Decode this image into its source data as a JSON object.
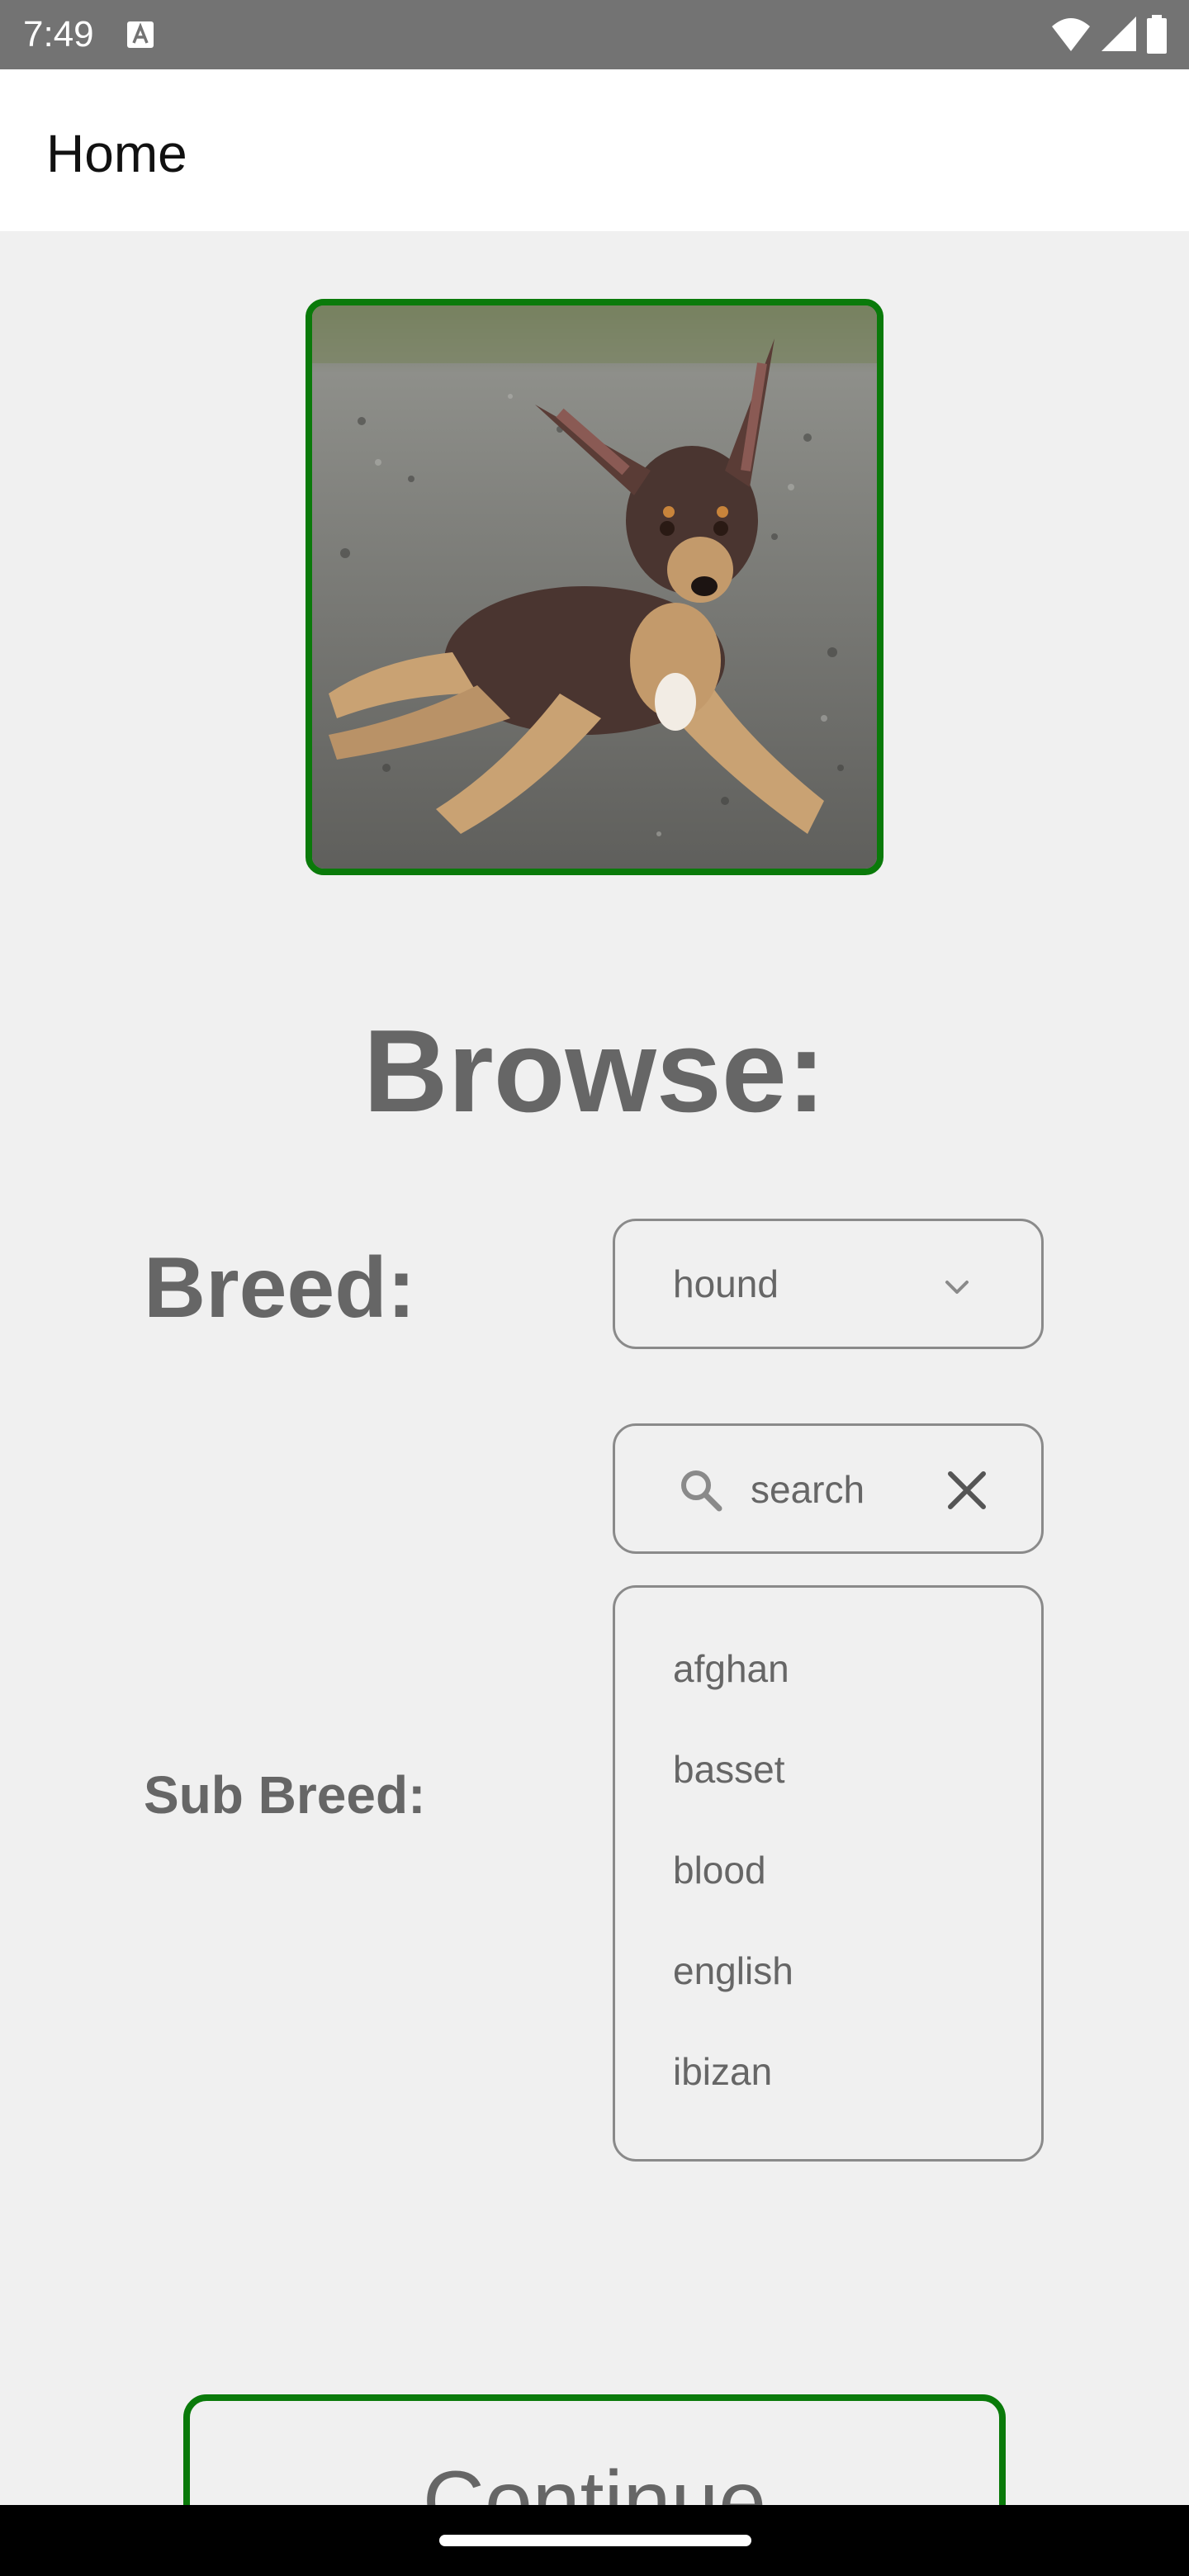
{
  "status_bar": {
    "time": "7:49"
  },
  "app_bar": {
    "title": "Home"
  },
  "main": {
    "browse_title": "Browse:",
    "breed_label": "Breed:",
    "breed_selected": "hound",
    "search_placeholder": "search",
    "sub_breed_label": "Sub Breed:",
    "sub_breeds": [
      "afghan",
      "basset",
      "blood",
      "english",
      "ibizan"
    ],
    "continue_label": "Continue"
  },
  "colors": {
    "accent_border": "#0a7a0a",
    "background": "#f0f0f0",
    "status_bar": "#737373"
  }
}
